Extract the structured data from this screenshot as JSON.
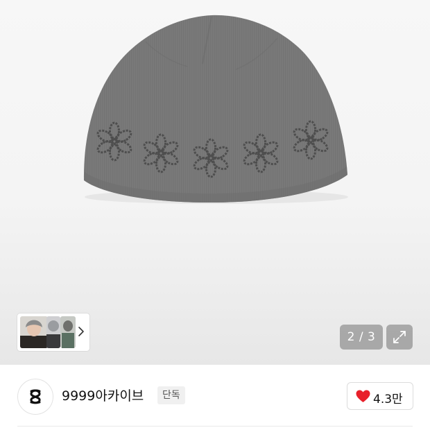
{
  "gallery": {
    "image_alt": "grey knit beanie with flower pattern",
    "pager_text": "2 / 3",
    "current_index": 2,
    "total_images": 3,
    "expand_icon": "expand-icon",
    "next_icon": "chevron-right-icon"
  },
  "store": {
    "name": "9999아카이브",
    "badge": "단독",
    "like_count": "4.3만",
    "like_icon": "heart-icon",
    "like_color": "#e8202a"
  },
  "colors": {
    "hat": "#7a7a7a",
    "pattern": "#4e4e4e",
    "hero_bg": "#f4f4f4"
  }
}
